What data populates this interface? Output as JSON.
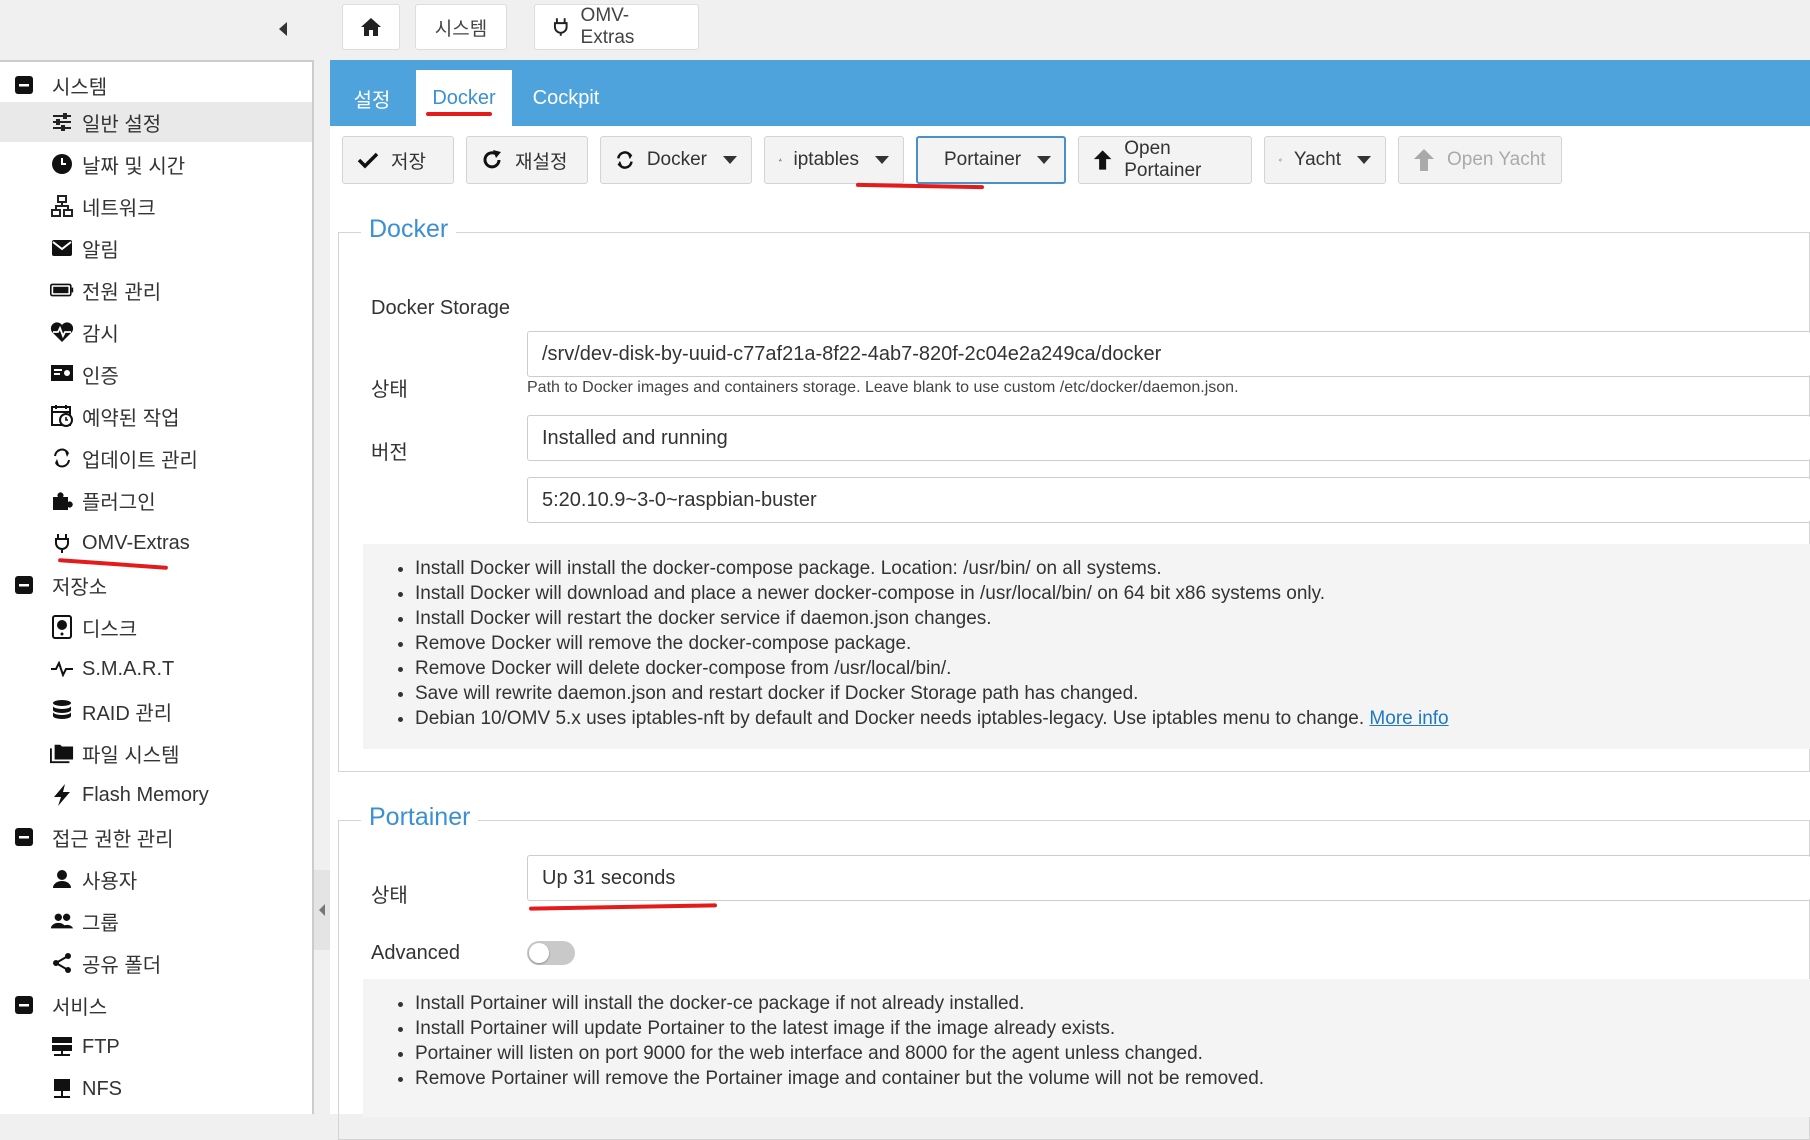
{
  "breadcrumb": {
    "home_icon": "home-icon",
    "items": [
      "시스템",
      "OMV-Extras"
    ]
  },
  "sidebar": {
    "groups": [
      {
        "label": "시스템",
        "items": [
          "일반 설정",
          "날짜 및 시간",
          "네트워크",
          "알림",
          "전원 관리",
          "감시",
          "인증",
          "예약된 작업",
          "업데이트 관리",
          "플러그인",
          "OMV-Extras"
        ]
      },
      {
        "label": "저장소",
        "items": [
          "디스크",
          "S.M.A.R.T",
          "RAID 관리",
          "파일 시스템",
          "Flash Memory"
        ]
      },
      {
        "label": "접근 권한 관리",
        "items": [
          "사용자",
          "그룹",
          "공유 폴더"
        ]
      },
      {
        "label": "서비스",
        "items": [
          "FTP",
          "NFS"
        ]
      }
    ]
  },
  "tabs": [
    "설정",
    "Docker",
    "Cockpit"
  ],
  "active_tab": "Docker",
  "toolbar": {
    "save": "저장",
    "reset": "재설정",
    "docker": "Docker",
    "iptables": "iptables",
    "portainer": "Portainer",
    "open_portainer": "Open Portainer",
    "yacht": "Yacht",
    "open_yacht": "Open Yacht"
  },
  "docker": {
    "legend": "Docker",
    "storage_label": "Docker Storage",
    "storage_value": "/srv/dev-disk-by-uuid-c77af21a-8f22-4ab7-820f-2c04e2a249ca/docker",
    "storage_hint": "Path to Docker images and containers storage. Leave blank to use custom /etc/docker/daemon.json.",
    "status_label": "상태",
    "status_value": "Installed and running",
    "version_label": "버전",
    "version_value": "5:20.10.9~3-0~raspbian-buster",
    "info": [
      "Install Docker will install the docker-compose package. Location: /usr/bin/ on all systems.",
      "Install Docker will download and place a newer docker-compose in /usr/local/bin/ on 64 bit x86 systems only.",
      "Install Docker will restart the docker service if daemon.json changes.",
      "Remove Docker will remove the docker-compose package.",
      "Remove Docker will delete docker-compose from /usr/local/bin/.",
      "Save will rewrite daemon.json and restart docker if Docker Storage path has changed."
    ],
    "info_last": "Debian 10/OMV 5.x uses iptables-nft by default and Docker needs iptables-legacy. Use iptables menu to change.",
    "more_info": "More info"
  },
  "portainer": {
    "legend": "Portainer",
    "status_label": "상태",
    "status_value": "Up 31 seconds",
    "advanced_label": "Advanced",
    "advanced_on": false,
    "info": [
      "Install Portainer will install the docker-ce package if not already installed.",
      "Install Portainer will update Portainer to the latest image if the image already exists.",
      "Portainer will listen on port 9000 for the web interface and 8000 for the agent unless changed.",
      "Remove Portainer will remove the Portainer image and container but the volume will not be removed."
    ]
  },
  "colors": {
    "accent": "#4ea3dd",
    "link": "#1f78c1",
    "annotation": "#e31b1b"
  }
}
